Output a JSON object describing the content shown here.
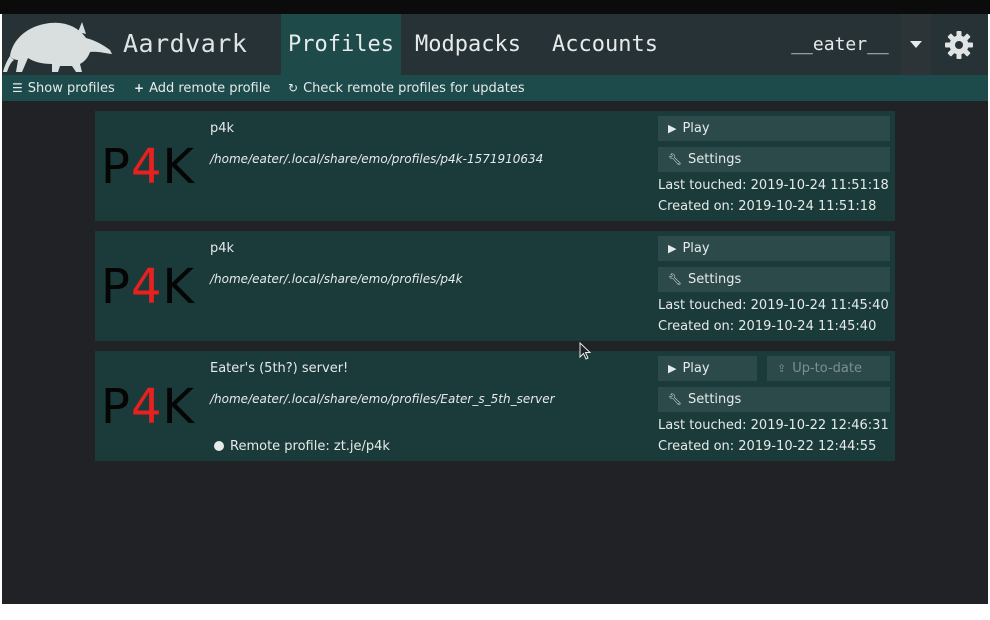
{
  "app": {
    "name": "Aardvark",
    "nav_tabs": [
      {
        "label": "Profiles",
        "active": true
      },
      {
        "label": "Modpacks"
      },
      {
        "label": "Accounts"
      }
    ],
    "account": "__eater__",
    "colors": {
      "navbar": "#263236",
      "active_tab": "#1f4a4a",
      "toolbar": "#1d4a4a",
      "card": "#1b3a3a",
      "button": "#2d4a4b",
      "logo_red": "#e82020"
    }
  },
  "toolbar": {
    "show_profiles": "Show profiles",
    "add_remote": "Add remote profile",
    "check_updates": "Check remote profiles for updates"
  },
  "profiles": [
    {
      "logo_left": "P",
      "logo_mid": "4",
      "logo_right": "K",
      "name": "p4k",
      "path": "/home/eater/.local/share/emo/profiles/p4k-1571910634",
      "play": "Play",
      "settings": "Settings",
      "last_touched": "Last touched: 2019-10-24 11:51:18",
      "created_on": "Created on: 2019-10-24 11:51:18"
    },
    {
      "logo_left": "P",
      "logo_mid": "4",
      "logo_right": "K",
      "name": "p4k",
      "path": "/home/eater/.local/share/emo/profiles/p4k",
      "play": "Play",
      "settings": "Settings",
      "last_touched": "Last touched: 2019-10-24 11:45:40",
      "created_on": "Created on: 2019-10-24 11:45:40"
    },
    {
      "logo_left": "P",
      "logo_mid": "4",
      "logo_right": "K",
      "name": "Eater's (5th?) server!",
      "path": "/home/eater/.local/share/emo/profiles/Eater_s_5th_server",
      "remote": "Remote profile: zt.je/p4k",
      "play": "Play",
      "uptodate": "Up-to-date",
      "settings": "Settings",
      "last_touched": "Last touched: 2019-10-22 12:46:31",
      "created_on": "Created on: 2019-10-22 12:44:55"
    }
  ]
}
